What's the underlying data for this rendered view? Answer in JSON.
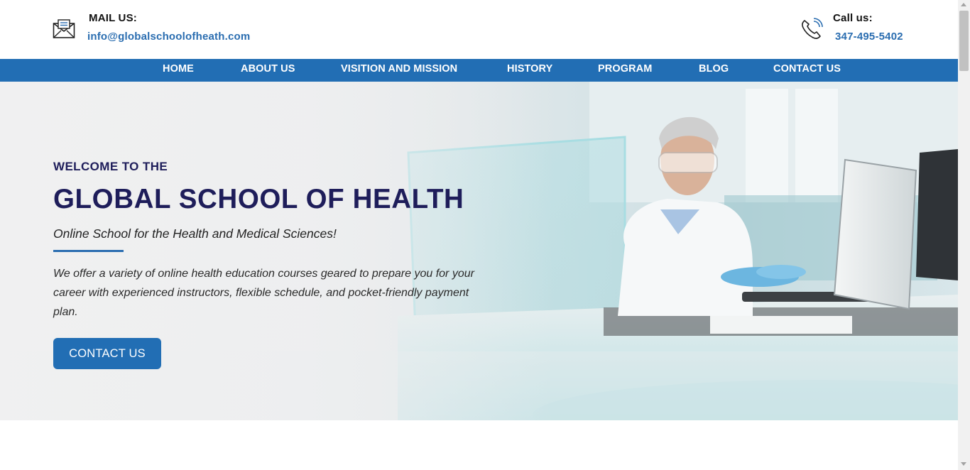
{
  "contact": {
    "mail": {
      "label": "MAIL US:",
      "value": "info@globalschoolofheath.com",
      "icon": "envelope-icon"
    },
    "call": {
      "label": "Call us:",
      "value": "347-495-5402",
      "icon": "phone-icon"
    }
  },
  "nav": {
    "items": [
      {
        "label": "HOME"
      },
      {
        "label": "ABOUT US"
      },
      {
        "label": "VISITION AND MISSION"
      },
      {
        "label": "HISTORY"
      },
      {
        "label": "PROGRAM"
      },
      {
        "label": "BLOG"
      },
      {
        "label": "CONTACT US"
      }
    ]
  },
  "hero": {
    "welcome": "WELCOME TO THE",
    "title": "GLOBAL SCHOOL OF HEALTH",
    "subtitle": "Online School for the Health and Medical Sciences!",
    "description": "We offer a variety of online health education courses geared to prepare you for your career with experienced instructors, flexible schedule, and pocket-friendly payment plan.",
    "cta_label": "CONTACT US"
  },
  "colors": {
    "brand_blue": "#226eb4",
    "link_blue": "#2a6db0",
    "heading_navy": "#1e1d5a"
  }
}
